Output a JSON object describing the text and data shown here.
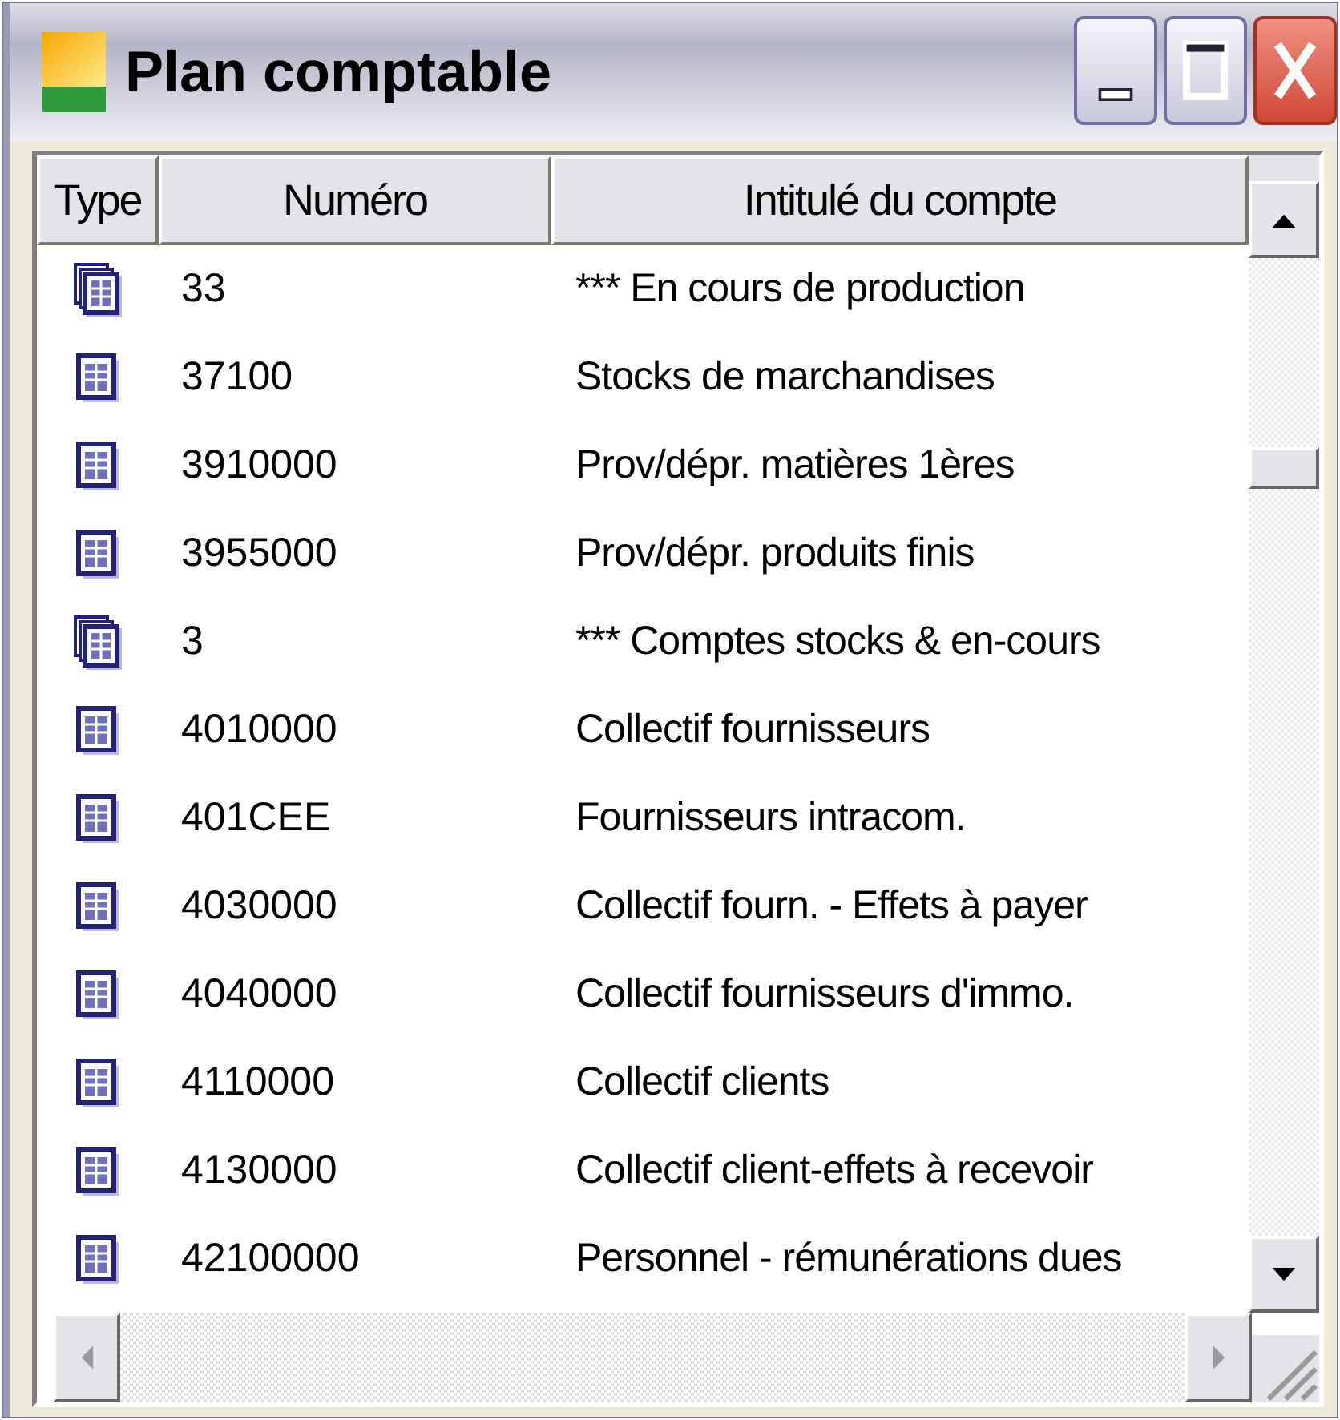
{
  "window": {
    "title": "Plan comptable"
  },
  "table": {
    "columns": [
      "Type",
      "Numéro",
      "Intitulé du compte"
    ],
    "rows": [
      {
        "kind": "group",
        "number": "33",
        "label": "*** En cours de production"
      },
      {
        "kind": "account",
        "number": "37100",
        "label": "Stocks de marchandises"
      },
      {
        "kind": "account",
        "number": "3910000",
        "label": "Prov/dépr.  matières 1ères"
      },
      {
        "kind": "account",
        "number": "3955000",
        "label": "Prov/dépr. produits finis"
      },
      {
        "kind": "group",
        "number": "3",
        "label": "*** Comptes stocks & en-cours"
      },
      {
        "kind": "account",
        "number": "4010000",
        "label": "Collectif fournisseurs"
      },
      {
        "kind": "account",
        "number": "401CEE",
        "label": "Fournisseurs intracom."
      },
      {
        "kind": "account",
        "number": "4030000",
        "label": "Collectif fourn. - Effets à payer"
      },
      {
        "kind": "account",
        "number": "4040000",
        "label": "Collectif fournisseurs d'immo."
      },
      {
        "kind": "account",
        "number": "4110000",
        "label": "Collectif clients"
      },
      {
        "kind": "account",
        "number": "4130000",
        "label": "Collectif client-effets à recevoir"
      },
      {
        "kind": "account",
        "number": "42100000",
        "label": "Personnel - rémunérations dues"
      }
    ]
  }
}
